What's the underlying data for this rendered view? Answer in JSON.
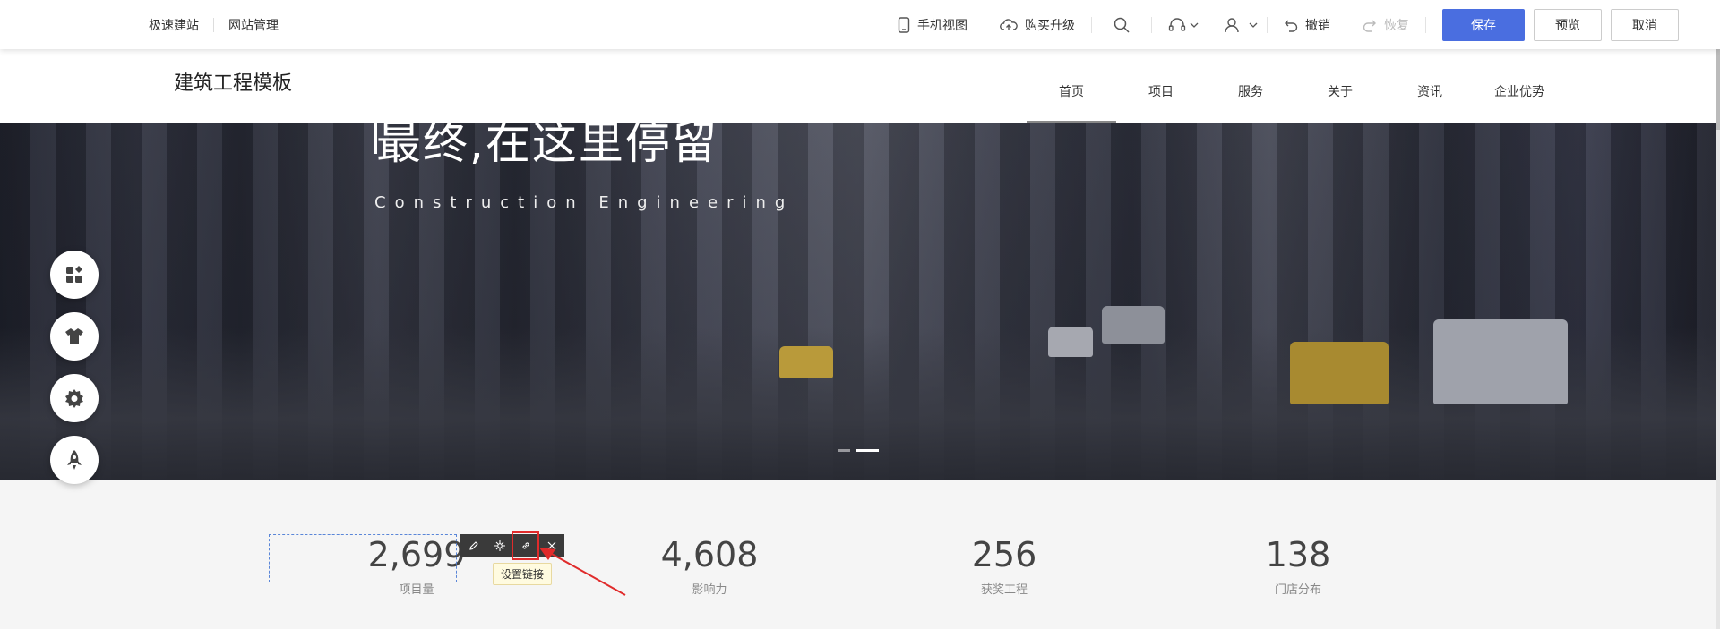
{
  "toolbar": {
    "left_items": [
      "极速建站",
      "网站管理"
    ],
    "mobile_view": "手机视图",
    "upgrade": "购买升级",
    "undo": "撤销",
    "redo": "恢复",
    "save": "保存",
    "preview": "预览",
    "cancel": "取消"
  },
  "site": {
    "title": "建筑工程模板",
    "nav": [
      "首页",
      "项目",
      "服务",
      "关于",
      "资讯",
      "企业优势"
    ]
  },
  "hero": {
    "headline": "最终,在这里停留",
    "subtitle": "Construction Engineering"
  },
  "stats": [
    {
      "value": "2,699",
      "label": "项目量"
    },
    {
      "value": "4,608",
      "label": "影响力"
    },
    {
      "value": "256",
      "label": "获奖工程"
    },
    {
      "value": "138",
      "label": "门店分布"
    }
  ],
  "edit_tooltip": "设置链接",
  "colors": {
    "primary": "#4a6ee0",
    "highlight": "#e02b2b",
    "selection": "#5a86d8"
  }
}
